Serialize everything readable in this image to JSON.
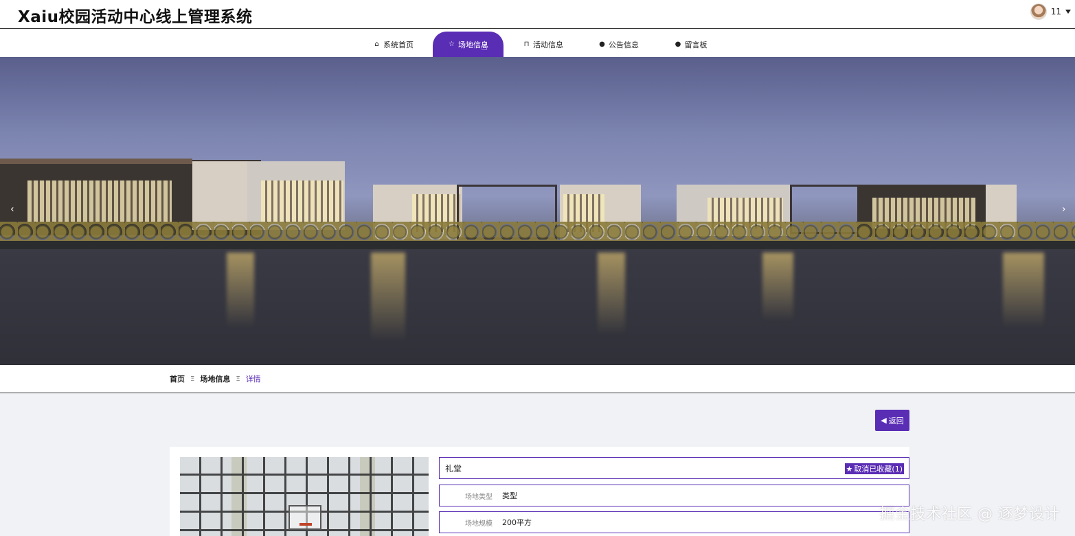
{
  "header": {
    "site_title": "Xaiu校园活动中心线上管理系统",
    "user_name": "11"
  },
  "nav": {
    "items": [
      {
        "label": "系统首页",
        "icon": "home-icon",
        "active": false
      },
      {
        "label": "场地信息",
        "icon": "star-icon",
        "active": true
      },
      {
        "label": "活动信息",
        "icon": "bag-icon",
        "active": false
      },
      {
        "label": "公告信息",
        "icon": "info-icon",
        "active": false
      },
      {
        "label": "留言板",
        "icon": "question-icon",
        "active": false
      }
    ]
  },
  "banner": {
    "prev_arrow": "‹",
    "next_arrow": "›"
  },
  "breadcrumb": {
    "items": [
      "首页",
      "场地信息",
      "详情"
    ],
    "separator": "Ξ"
  },
  "actions": {
    "back_label": "返回"
  },
  "venue": {
    "name": "礼堂",
    "favorite_label": "取消已收藏(1)",
    "fields": [
      {
        "label": "场地类型",
        "value": "类型"
      },
      {
        "label": "场地规模",
        "value": "200平方"
      }
    ]
  },
  "watermark": "掘金技术社区 @ 逐梦设计",
  "colors": {
    "accent": "#5a2db5"
  }
}
